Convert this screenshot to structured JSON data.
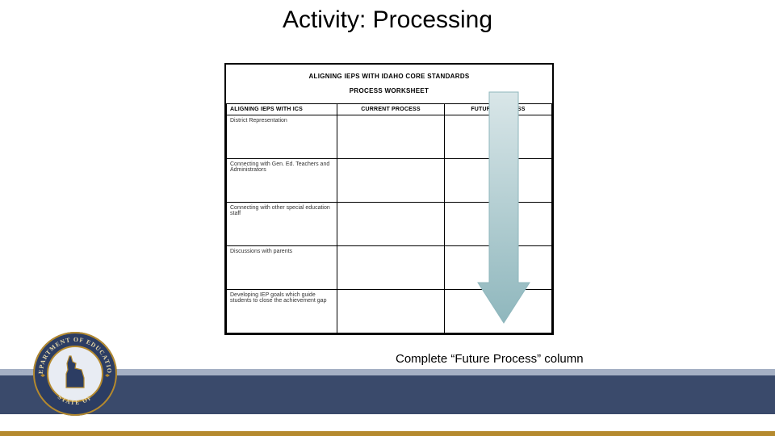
{
  "title": "Activity: Processing",
  "worksheet": {
    "heading_line1": "ALIGNING IEPS WITH IDAHO CORE STANDARDS",
    "heading_line2": "PROCESS WORKSHEET",
    "columns": {
      "c0": "ALIGNING IEPS WITH ICS",
      "c1": "CURRENT PROCESS",
      "c2": "FUTURE PROCESS"
    },
    "rows": [
      {
        "label": "District Representation"
      },
      {
        "label": "Connecting with Gen. Ed. Teachers and Administrators"
      },
      {
        "label": "Connecting with other special education staff"
      },
      {
        "label": "Discussions with parents"
      },
      {
        "label": "Developing IEP goals which guide students to close the achievement gap"
      }
    ]
  },
  "caption": "Complete “Future Process” column",
  "seal": {
    "outer_text_top": "DEPARTMENT OF EDUCATION",
    "outer_text_bottom": "STATE OF",
    "colors": {
      "ring": "#2c3d63",
      "gold": "#b58a2e",
      "inner": "#e8ecf3"
    }
  },
  "arrow": {
    "fill_top": "#d9e6e8",
    "fill_bottom": "#8fb7bd",
    "stroke": "#8fb7bd"
  }
}
